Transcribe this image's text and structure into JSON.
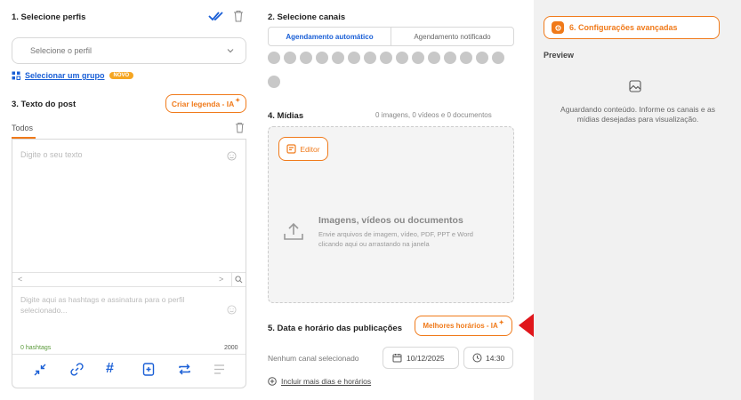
{
  "profiles": {
    "title": "1. Selecione perfis",
    "select_placeholder": "Selecione o perfil",
    "group_link": "Selecionar um grupo",
    "new_badge": "NOVO"
  },
  "post_text": {
    "title": "3. Texto do post",
    "ai_caption_button": "Criar legenda - IA",
    "tab_all": "Todos",
    "text_placeholder": "Digite o seu texto",
    "hashtag_placeholder": "Digite aqui as hashtags e assinatura para o perfil selecionado...",
    "hashtag_count": "0 hashtags",
    "char_limit": "2000"
  },
  "channels": {
    "title": "2. Selecione canais",
    "tab_auto": "Agendamento automático",
    "tab_notified": "Agendamento notificado",
    "icons": [
      "globe-icon",
      "threads-icon",
      "instagram-icon",
      "facebook-icon",
      "facebook-alt-icon",
      "youtube-icon",
      "x-icon",
      "tiktok-icon",
      "linkedin-icon",
      "pinterest-icon",
      "kwai-icon",
      "google-icon",
      "gmb-icon",
      "email-icon",
      "whatsapp-icon",
      "threads-alt-icon"
    ]
  },
  "media": {
    "title": "4. Mídias",
    "counts": "0 imagens, 0 vídeos e 0 documentos",
    "editor_button": "Editor",
    "drop_title": "Imagens, vídeos ou documentos",
    "drop_sub1": "Envie arquivos de imagem, vídeo, PDF, PPT e Word",
    "drop_sub2": "clicando aqui ou arrastando na janela"
  },
  "schedule": {
    "title": "5. Data e horário das publicações",
    "best_times_button": "Melhores horários - IA",
    "no_channel": "Nenhum canal selecionado",
    "date": "10/12/2025",
    "time": "14:30",
    "add_more": "Incluir mais dias e horários"
  },
  "advanced": {
    "button": "6. Configurações avançadas",
    "preview_title": "Preview",
    "preview_text": "Aguardando conteúdo. Informe os canais e as mídias desejadas para visualização."
  },
  "colors": {
    "accent": "#f07a1a",
    "link": "#1a5fd6",
    "arrow": "#e0161b",
    "panel": "#f1f1f1"
  }
}
